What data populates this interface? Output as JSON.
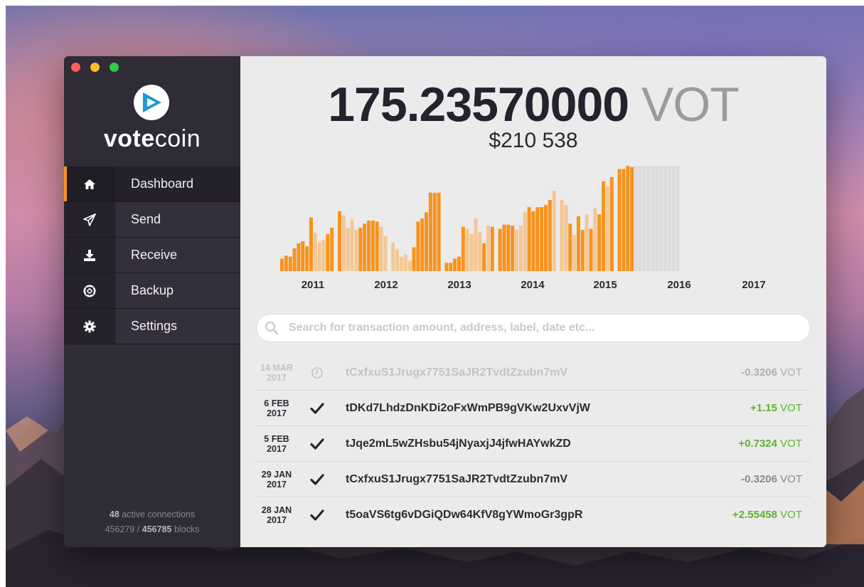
{
  "app": {
    "name_bold": "vote",
    "name_light": "coin"
  },
  "nav": [
    {
      "label": "Dashboard",
      "icon": "home-icon",
      "active": true
    },
    {
      "label": "Send",
      "icon": "paper-plane-icon",
      "active": false
    },
    {
      "label": "Receive",
      "icon": "download-icon",
      "active": false
    },
    {
      "label": "Backup",
      "icon": "lifebuoy-icon",
      "active": false
    },
    {
      "label": "Settings",
      "icon": "gear-icon",
      "active": false
    }
  ],
  "status": {
    "connections": "48",
    "connections_label": "active connections",
    "blocks_current": "456279",
    "blocks_separator": "/",
    "blocks_total": "456785",
    "blocks_label": "blocks"
  },
  "balance": {
    "amount": "175.23570000",
    "unit": "VOT",
    "fiat": "$210 538"
  },
  "chart_data": {
    "type": "bar",
    "x_tick_labels": [
      "2011",
      "2012",
      "2013",
      "2014",
      "2015",
      "2016",
      "2017"
    ],
    "series_heights": [
      12,
      15,
      14,
      22,
      27,
      29,
      24,
      52,
      37,
      28,
      30,
      36,
      42,
      58,
      54,
      42,
      50,
      40,
      42,
      46,
      49,
      49,
      48,
      43,
      34,
      28,
      21,
      14,
      16,
      10,
      23,
      48,
      51,
      57,
      76,
      76,
      76,
      8,
      8,
      12,
      14,
      43,
      41,
      36,
      51,
      38,
      27,
      44,
      43,
      41,
      45,
      45,
      44,
      40,
      44,
      57,
      62,
      58,
      62,
      62,
      64,
      69,
      78,
      69,
      64,
      46,
      35,
      53,
      40,
      55,
      41,
      61,
      55,
      87,
      82,
      91,
      99,
      99,
      102,
      101
    ],
    "series_colors_dark": "#f7931e",
    "series_colors_light": "#f3c795",
    "future_bars": 11,
    "future_color": "#dcdcdc"
  },
  "search": {
    "placeholder": "Search for transaction amount, address, label, date etc..."
  },
  "transactions": [
    {
      "day": "14 MAR",
      "year": "2017",
      "status": "pending",
      "address": "tCxfxuS1Jrugx7751SaJR2TvdtZzubn7mV",
      "amount": "-0.3206",
      "unit": "VOT",
      "sign": "neg"
    },
    {
      "day": "6 FEB",
      "year": "2017",
      "status": "confirmed",
      "address": "tDKd7LhdzDnKDi2oFxWmPB9gVKw2UxvVjW",
      "amount": "+1.15",
      "unit": "VOT",
      "sign": "pos"
    },
    {
      "day": "5 FEB",
      "year": "2017",
      "status": "confirmed",
      "address": "tJqe2mL5wZHsbu54jNyaxjJ4jfwHAYwkZD",
      "amount": "+0.7324",
      "unit": "VOT",
      "sign": "pos"
    },
    {
      "day": "29 JAN",
      "year": "2017",
      "status": "confirmed",
      "address": "tCxfxuS1Jrugx7751SaJR2TvdtZzubn7mV",
      "amount": "-0.3206",
      "unit": "VOT",
      "sign": "neg"
    },
    {
      "day": "28 JAN",
      "year": "2017",
      "status": "confirmed",
      "address": "t5oaVS6tg6vDGiQDw64KfV8gYWmoGr3gpR",
      "amount": "+2.55458",
      "unit": "VOT",
      "sign": "pos"
    }
  ]
}
